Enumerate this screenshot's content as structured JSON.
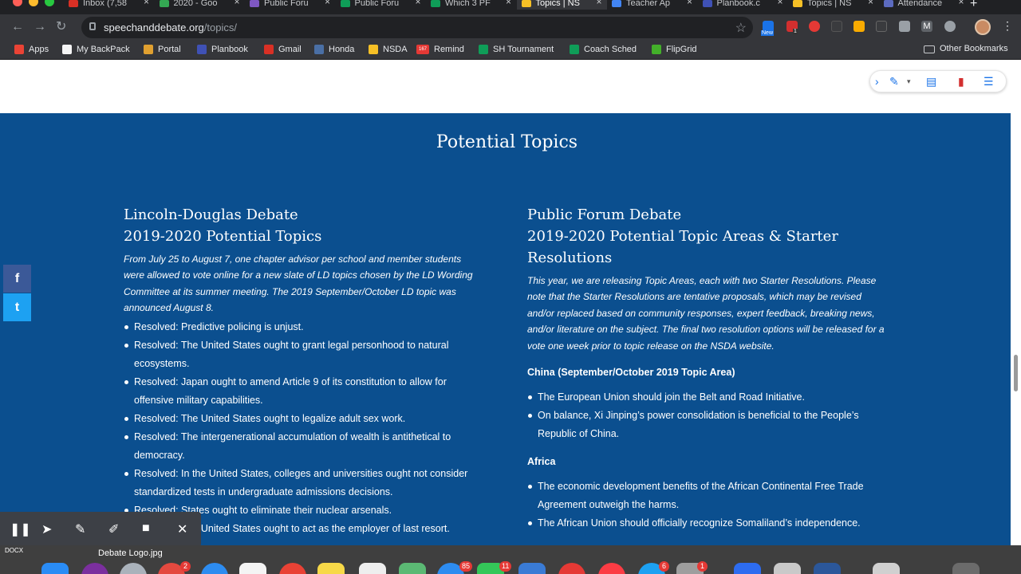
{
  "browser": {
    "tabs": [
      {
        "title": "Inbox (7,58",
        "favicon_color": "#d93025",
        "active": false
      },
      {
        "title": "2020 - Goo",
        "favicon_color": "#34a853",
        "active": false
      },
      {
        "title": "Public Foru",
        "favicon_color": "#7e57c2",
        "active": false
      },
      {
        "title": "Public Foru",
        "favicon_color": "#0f9d58",
        "active": false
      },
      {
        "title": "Which 3 PF",
        "favicon_color": "#0f9d58",
        "active": false
      },
      {
        "title": "Topics | NS",
        "favicon_color": "#f6c026",
        "active": true
      },
      {
        "title": "Teacher Ap",
        "favicon_color": "#4285f4",
        "active": false
      },
      {
        "title": "Planbook.c",
        "favicon_color": "#3f51b5",
        "active": false
      },
      {
        "title": "Topics | NS",
        "favicon_color": "#f6c026",
        "active": false
      },
      {
        "title": "Attendance",
        "favicon_color": "#5c6bc0",
        "active": false
      }
    ],
    "url_domain": "speechanddebate.org",
    "url_path": "/topics/",
    "extension_badges": {
      "new_label": "New",
      "abp_count": "1"
    },
    "bookmarks": [
      {
        "label": "Apps",
        "color": "#ea4335"
      },
      {
        "label": "My BackPack",
        "color": "#f5f5f5"
      },
      {
        "label": "Portal",
        "color": "#e0a030"
      },
      {
        "label": "Planbook",
        "color": "#3f51b5"
      },
      {
        "label": "Gmail",
        "color": "#d93025"
      },
      {
        "label": "Honda",
        "color": "#4a6fa5"
      },
      {
        "label": "NSDA",
        "color": "#f6c026"
      },
      {
        "label": "Remind",
        "color": "#e53935"
      },
      {
        "label": "SH Tournament",
        "color": "#0f9d58"
      },
      {
        "label": "Coach Sched",
        "color": "#0f9d58"
      },
      {
        "label": "FlipGrid",
        "color": "#43b02a"
      }
    ],
    "remind_icon_text": "167",
    "other_bookmarks": "Other Bookmarks"
  },
  "page": {
    "section_title": "Potential Topics",
    "ld": {
      "title_line1": "Lincoln-Douglas Debate",
      "title_line2": "2019-2020 Potential Topics",
      "intro": "From July 25 to August 7, one chapter advisor per school and member students were allowed to vote online for a new slate of LD topics chosen by the LD Wording Committee at its summer meeting. The 2019 September/October LD topic was announced August 8.",
      "items": [
        "Resolved: Predictive policing is unjust.",
        "Resolved: The United States ought to grant legal personhood to natural ecosystems.",
        "Resolved: Japan ought to amend Article 9 of its constitution to allow for offensive military capabilities.",
        "Resolved: The United States ought to legalize adult sex work.",
        "Resolved: The intergenerational accumulation of wealth is antithetical to democracy.",
        "Resolved: In the United States, colleges and universities ought not consider standardized tests in undergraduate admissions decisions.",
        "Resolved: States ought to eliminate their nuclear arsenals.",
        "Resolved: The United States ought to act as the employer of last resort."
      ]
    },
    "pf": {
      "title_line1": "Public Forum Debate",
      "title_line2": "2019-2020 Potential Topic Areas & Starter Resolutions",
      "intro": "This year, we are releasing Topic Areas, each with two Starter Resolutions. Please note that the Starter Resolutions are tentative proposals, which may be revised and/or replaced based on community responses, expert feedback, breaking news, and/or literature on the subject. The final two resolution options will be released for a vote one week prior to topic release on the NSDA website.",
      "areas": [
        {
          "heading": "China (September/October 2019 Topic Area)",
          "items": [
            "The European Union should join the Belt and Road Initiative.",
            "On balance, Xi Jinping’s power consolidation is beneficial to the People’s Republic of China."
          ]
        },
        {
          "heading": "Africa",
          "items": [
            "The economic development benefits of the African Continental Free Trade Agreement outweigh the harms.",
            "The African Union should officially recognize Somaliland’s independence."
          ]
        }
      ]
    },
    "social": {
      "facebook": "f",
      "twitter": "t"
    }
  },
  "dock": {
    "file_label": "DOCX",
    "filename": "Debate Logo.jpg",
    "badges": [
      "2",
      "85",
      "11",
      "6",
      "1"
    ]
  },
  "colors": {
    "page_blue": "#0b4f8f",
    "chrome_dark": "#35363a",
    "facebook": "#3b5998",
    "twitter": "#1da1f2"
  }
}
